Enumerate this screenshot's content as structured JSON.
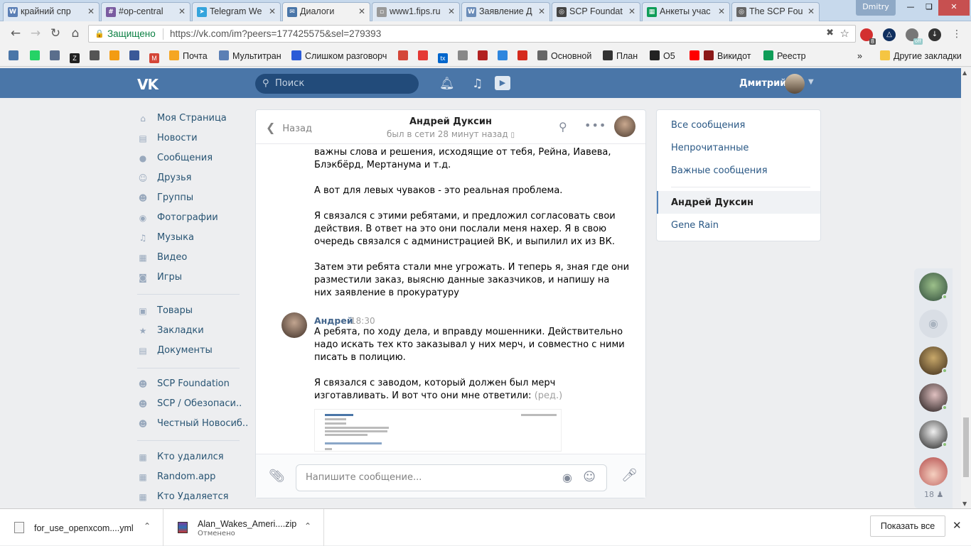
{
  "browser": {
    "tabs": [
      {
        "title": "крайний спр",
        "color": "#5b7fb5",
        "glyph": "W",
        "active": false
      },
      {
        "title": "#op-central",
        "color": "#7a5ba0",
        "glyph": "#",
        "active": false
      },
      {
        "title": "Telegram We",
        "color": "#35a4dc",
        "glyph": "➤",
        "active": false
      },
      {
        "title": "Диалоги",
        "color": "#4a76a8",
        "glyph": "✉",
        "active": true
      },
      {
        "title": "www1.fips.ru",
        "color": "#999999",
        "glyph": "▫",
        "active": false
      },
      {
        "title": "Заявление Д",
        "color": "#6b8cb8",
        "glyph": "W",
        "active": false
      },
      {
        "title": "SCP Foundat",
        "color": "#444444",
        "glyph": "◎",
        "active": false
      },
      {
        "title": "Анкеты учас",
        "color": "#0f9d58",
        "glyph": "▦",
        "active": false
      },
      {
        "title": "The SCP Fou",
        "color": "#666666",
        "glyph": "◎",
        "active": false
      }
    ],
    "profile_name": "Dmitry",
    "secure_label": "Защищено",
    "url": "https://vk.com/im?peers=177425575&sel=279393",
    "ext_badge_1": "8",
    "ext_badge_2": "off",
    "bookmarks": [
      {
        "label": "",
        "color": "#4a76a8"
      },
      {
        "label": "",
        "color": "#25d366"
      },
      {
        "label": "",
        "color": "#5a6e8c"
      },
      {
        "label": "",
        "color": "#222222",
        "glyph": "Z"
      },
      {
        "label": "",
        "color": "#555555"
      },
      {
        "label": "",
        "color": "#f39c12"
      },
      {
        "label": "",
        "color": "#3b5998"
      },
      {
        "label": "",
        "color": "#d44638",
        "glyph": "M"
      },
      {
        "label": "Почта",
        "color": "#f5a623"
      },
      {
        "label": "Мультитран",
        "color": "#5b7fb5"
      },
      {
        "label": "Слишком разговорч",
        "color": "#2a5bd7"
      },
      {
        "label": "",
        "color": "#d44638"
      },
      {
        "label": "",
        "color": "#e53935"
      },
      {
        "label": "",
        "color": "#0066cc",
        "glyph": "tx"
      },
      {
        "label": "",
        "color": "#888888"
      },
      {
        "label": "",
        "color": "#b22222"
      },
      {
        "label": "",
        "color": "#2e86de"
      },
      {
        "label": "",
        "color": "#d52b1e"
      },
      {
        "label": "Основной",
        "color": "#666666"
      },
      {
        "label": "План",
        "color": "#333333"
      },
      {
        "label": "O5",
        "color": "#222222"
      },
      {
        "label": "",
        "color": "#ff0000"
      },
      {
        "label": "Викидот",
        "color": "#8b1a1a"
      },
      {
        "label": "Реестр",
        "color": "#0f9d58"
      }
    ],
    "other_bookmarks": "Другие закладки",
    "more_bookmarks": "»"
  },
  "vk_header": {
    "logo": "VK",
    "search_placeholder": "Поиск",
    "user_name": "Дмитрий"
  },
  "left_nav": {
    "main": [
      "Моя Страница",
      "Новости",
      "Сообщения",
      "Друзья",
      "Группы",
      "Фотографии",
      "Музыка",
      "Видео",
      "Игры"
    ],
    "main_icons": [
      "home-icon",
      "news-icon",
      "messages-icon",
      "friends-icon",
      "groups-icon",
      "photos-icon",
      "music-icon",
      "video-icon",
      "games-icon"
    ],
    "shop": [
      "Товары",
      "Закладки",
      "Документы"
    ],
    "shop_icons": [
      "goods-icon",
      "bookmarks-icon",
      "documents-icon"
    ],
    "groups": [
      "SCP Foundation",
      "SCP / Обезопаси..",
      "Честный Новосиб.."
    ],
    "apps": [
      "Кто удалился",
      "Random.app",
      "Кто Удаляется"
    ]
  },
  "chat": {
    "back_label": "Назад",
    "contact_name": "Андрей Дуксин",
    "status": "был в сети 28 минут назад",
    "messages_prev": [
      "важны слова и решения, исходящие от тебя, Рейна, Иавева,",
      "Блэкбёрд, Мертанума и т.д.",
      "",
      "А вот для левых чуваков - это реальная проблема.",
      "",
      "Я связался с этими ребятами, и предложил согласовать свои",
      "действия. В ответ на это они послали меня нахер. Я в свою",
      "очередь связался с администрацией ВК, и выпилил их из ВК.",
      "",
      "Затем эти ребята стали мне угрожать. И теперь я, зная где они",
      "разместили заказ, выясню данные заказчиков, и напишу на",
      "них заявление в прокуратуру"
    ],
    "author": "Андрей",
    "time": "18:30",
    "message_lines": [
      "А ребята, по ходу дела, и вправду мошенники. Действительно",
      "надо искать тех кто заказывал у них мерч, и совместно с ними",
      "писать в полицию.",
      "",
      "Я связался с заводом, который должен был мерч"
    ],
    "last_line": "изготавливать. И вот что они мне ответили:",
    "edited": "(ред.)",
    "composer_placeholder": "Напишите сообщение..."
  },
  "right_nav": {
    "items": [
      "Все сообщения",
      "Непрочитанные",
      "Важные сообщения"
    ],
    "convs": [
      "Андрей Дуксин",
      "Gene Rain"
    ]
  },
  "friends_strip": {
    "count": "18"
  },
  "downloads": [
    {
      "name": "for_use_openxcom....yml",
      "sub": ""
    },
    {
      "name": "Alan_Wakes_Ameri....zip",
      "sub": "Отменено"
    }
  ],
  "show_all_label": "Показать все"
}
